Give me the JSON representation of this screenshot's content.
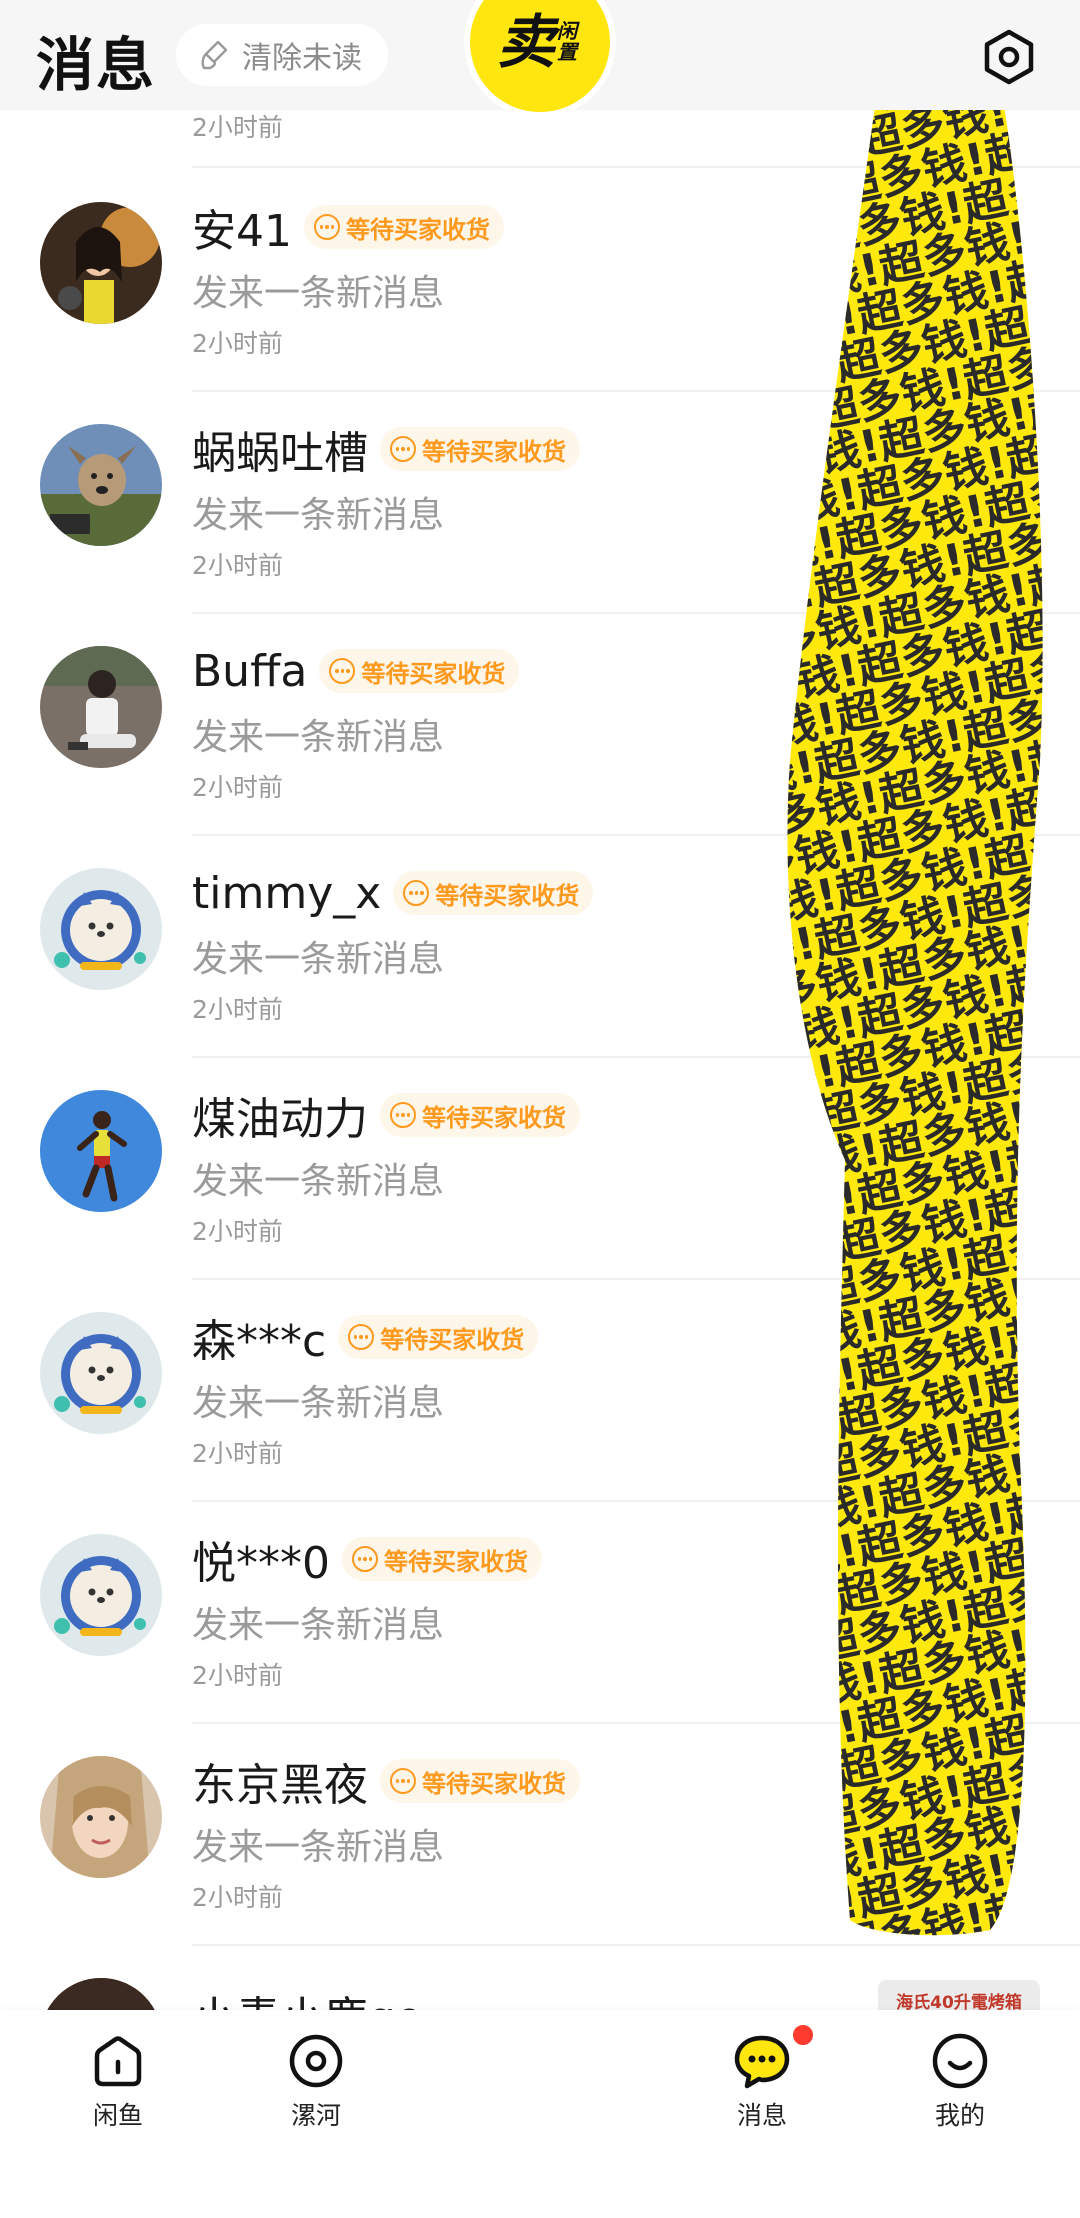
{
  "header": {
    "title": "消息",
    "clear_label": "清除未读"
  },
  "top_partial": {
    "time": "2小时前"
  },
  "messages": [
    {
      "name": "安41",
      "badge": "等待买家收货",
      "preview": "发来一条新消息",
      "time": "2小时前",
      "avatar": "woman-portrait"
    },
    {
      "name": "蜗蜗吐槽",
      "badge": "等待买家收货",
      "preview": "发来一条新消息",
      "time": "2小时前",
      "avatar": "dog-photo"
    },
    {
      "name": "Buffa",
      "badge": "等待买家收货",
      "preview": "发来一条新消息",
      "time": "2小时前",
      "avatar": "person-sitting"
    },
    {
      "name": "timmy_x",
      "badge": "等待买家收货",
      "preview": "发来一条新消息",
      "time": "2小时前",
      "avatar": "default-cat"
    },
    {
      "name": "煤油动力",
      "badge": "等待买家收货",
      "preview": "发来一条新消息",
      "time": "2小时前",
      "avatar": "runner-photo"
    },
    {
      "name": "森***c",
      "badge": "等待买家收货",
      "preview": "发来一条新消息",
      "time": "2小时前",
      "avatar": "default-cat"
    },
    {
      "name": "悦***0",
      "badge": "等待买家收货",
      "preview": "发来一条新消息",
      "time": "2小时前",
      "avatar": "default-cat"
    },
    {
      "name": "东京黑夜",
      "badge": "等待买家收货",
      "preview": "发来一条新消息",
      "time": "2小时前",
      "avatar": "woman-face"
    }
  ],
  "last_partial": {
    "name": "小青小鹿go",
    "product_tag": "海氏40升電烤箱"
  },
  "sticker": {
    "text": "超多钱!"
  },
  "bottom_nav": {
    "home": "闲鱼",
    "river": "漯河",
    "sell_main": "卖",
    "sell_sub": "闲置",
    "messages": "消息",
    "mine": "我的"
  },
  "colors": {
    "accent_yellow": "#ffe60f",
    "badge_orange": "#ff9a1e",
    "notify_red": "#ff3b30"
  }
}
